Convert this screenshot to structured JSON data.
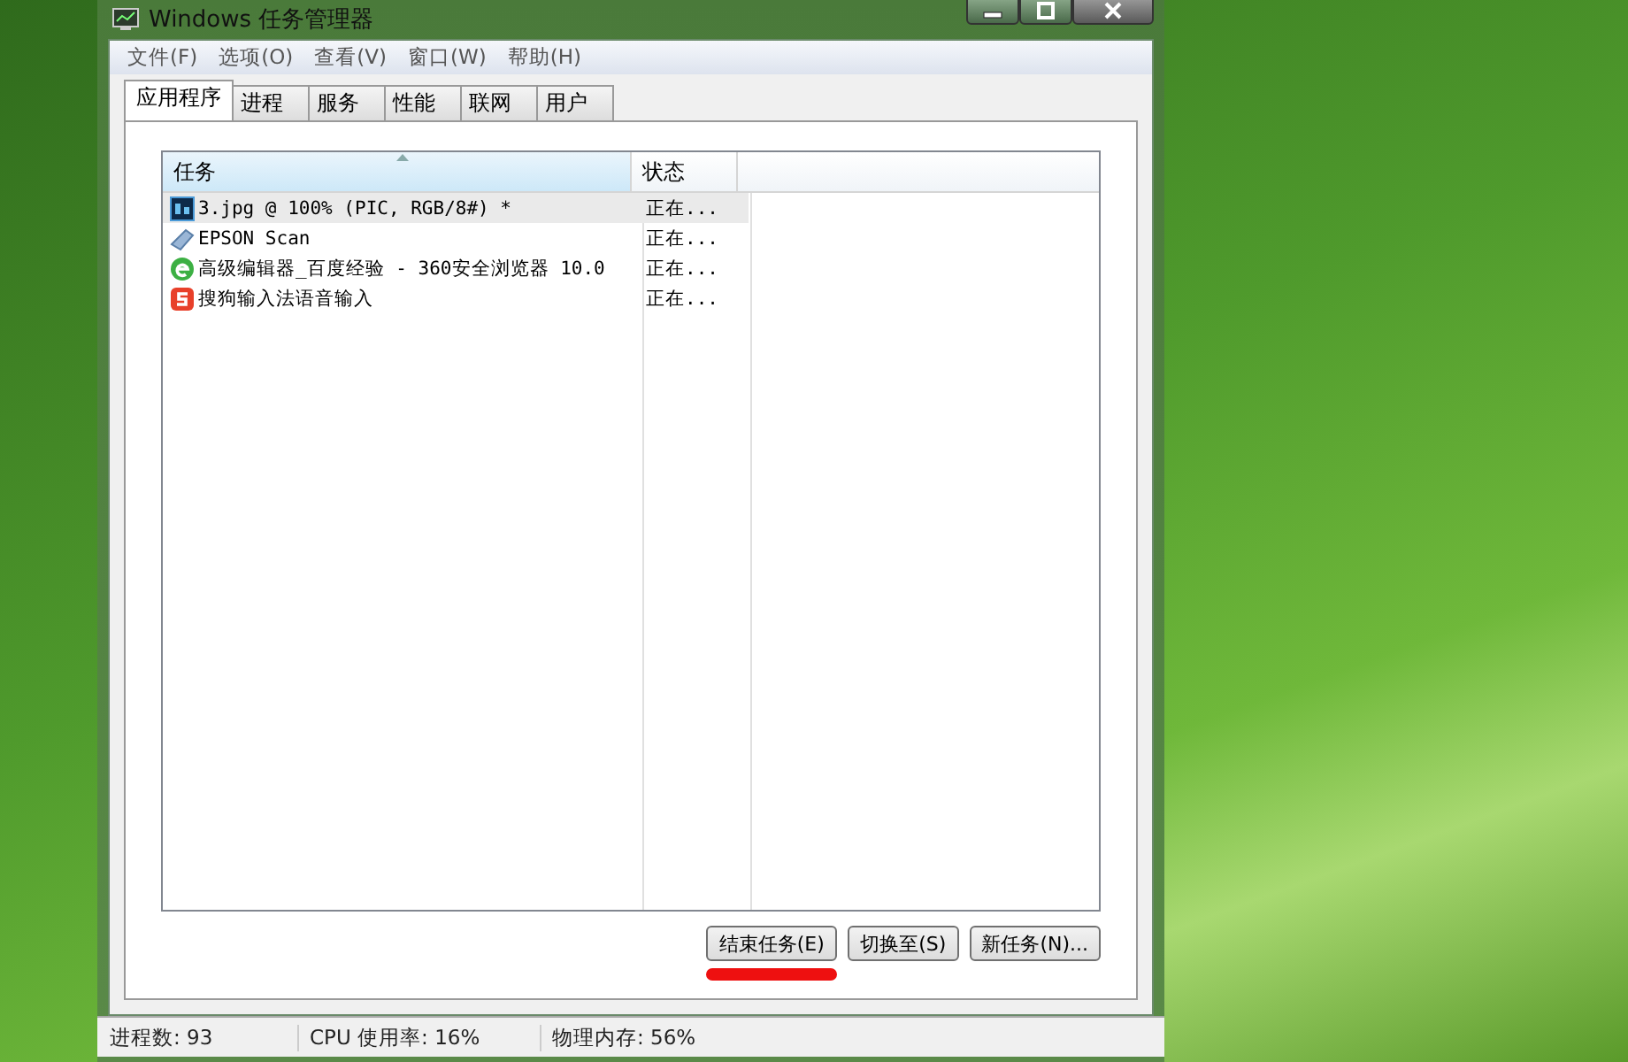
{
  "window": {
    "title": "Windows 任务管理器"
  },
  "menu": [
    {
      "label": "文件(F)"
    },
    {
      "label": "选项(O)"
    },
    {
      "label": "查看(V)"
    },
    {
      "label": "窗口(W)"
    },
    {
      "label": "帮助(H)"
    }
  ],
  "tabs": [
    {
      "label": "应用程序",
      "selected": true
    },
    {
      "label": "进程",
      "selected": false
    },
    {
      "label": "服务",
      "selected": false
    },
    {
      "label": "性能",
      "selected": false
    },
    {
      "label": "联网",
      "selected": false
    },
    {
      "label": "用户",
      "selected": false
    }
  ],
  "table": {
    "columns": [
      "任务",
      "状态"
    ],
    "rows": [
      {
        "kind": "square",
        "task": "3.jpg @ 100% (PIC, RGB/8#) *",
        "status": "正在...",
        "selected": true
      },
      {
        "kind": "scanner",
        "task": "EPSON Scan",
        "status": "正在...",
        "selected": false
      },
      {
        "kind": "globe",
        "task": "高级编辑器_百度经验 - 360安全浏览器 10.0",
        "status": "正在...",
        "selected": false
      },
      {
        "kind": "badge",
        "task": "搜狗输入法语音输入",
        "status": "正在...",
        "selected": false
      }
    ]
  },
  "buttons": [
    "结束任务(E)",
    "切换至(S)",
    "新任务(N)..."
  ],
  "status_bar": [
    "进程数: 93",
    "CPU 使用率: 16%",
    "物理内存: 56%"
  ]
}
